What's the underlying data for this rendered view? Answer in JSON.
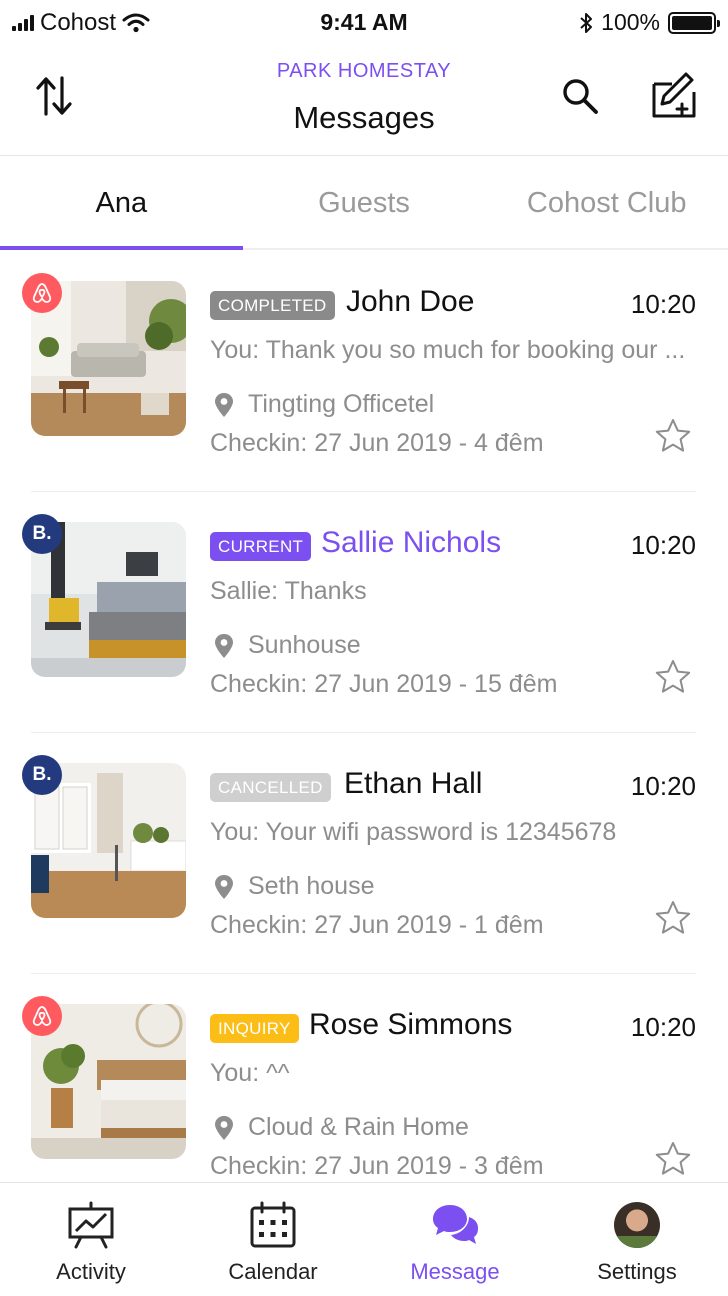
{
  "status_bar": {
    "carrier": "Cohost",
    "time": "9:41 AM",
    "battery": "100%"
  },
  "header": {
    "subtitle": "PARK HOMESTAY",
    "title": "Messages"
  },
  "tabs": [
    {
      "label": "Ana",
      "active": true
    },
    {
      "label": "Guests",
      "active": false
    },
    {
      "label": "Cohost Club",
      "active": false
    }
  ],
  "conversations": [
    {
      "source": "airbnb",
      "status": "COMPLETED",
      "name": "John Doe",
      "time": "10:20",
      "preview": "You: Thank you so much for booking our ...",
      "location": "Tingting Officetel",
      "checkin": "Checkin: 27 Jun 2019 - 4 đêm"
    },
    {
      "source": "booking",
      "status": "CURRENT",
      "name": "Sallie Nichols",
      "time": "10:20",
      "preview": "Sallie: Thanks",
      "location": "Sunhouse",
      "checkin": "Checkin: 27 Jun 2019 - 15 đêm"
    },
    {
      "source": "booking",
      "status": "CANCELLED",
      "name": "Ethan Hall",
      "time": "10:20",
      "preview": "You: Your wifi password is 12345678",
      "location": "Seth house",
      "checkin": "Checkin: 27 Jun 2019 - 1 đêm"
    },
    {
      "source": "airbnb",
      "status": "INQUIRY",
      "name": "Rose Simmons",
      "time": "10:20",
      "preview": "You: ^^",
      "location": "Cloud & Rain Home",
      "checkin": "Checkin: 27 Jun 2019 - 3 đêm"
    }
  ],
  "booking_badge_letter": "B.",
  "bottom_nav": [
    {
      "label": "Activity",
      "icon": "activity-chart-icon",
      "active": false
    },
    {
      "label": "Calendar",
      "icon": "calendar-icon",
      "active": false
    },
    {
      "label": "Message",
      "icon": "chat-bubbles-icon",
      "active": true
    },
    {
      "label": "Settings",
      "icon": "user-avatar",
      "active": false
    }
  ],
  "colors": {
    "accent": "#7b4ff0",
    "airbnb": "#ff5a5f",
    "booking": "#233a7f",
    "completed": "#8a8a8a",
    "cancelled": "#cfcfcf",
    "inquiry": "#fbbd16"
  }
}
